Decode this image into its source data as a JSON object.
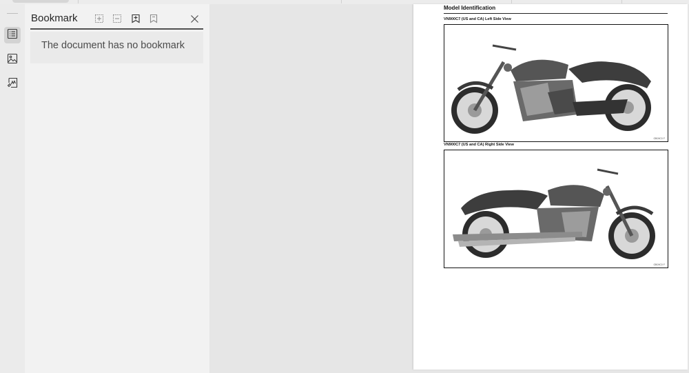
{
  "sidebar_tool_icons": [
    "bookmark-list-icon",
    "image-icon",
    "signature-icon"
  ],
  "bookmark_panel": {
    "title": "Bookmark",
    "header_icons": [
      "expand-all-icon",
      "collapse-all-icon",
      "add-bookmark-icon",
      "bookmark-icon",
      "close-icon"
    ],
    "empty_message": "The document has no bookmark"
  },
  "document": {
    "section_title": "Model Identification",
    "figures": [
      {
        "caption": "VN900C7 (US and CA) Left Side View",
        "code": "GB09C0 F",
        "view": "left"
      },
      {
        "caption": "VN900C7 (US and CA) Right Side View",
        "code": "GB09C0 F",
        "view": "right"
      }
    ]
  },
  "colors": {
    "panel_bg": "#f2f2f2",
    "canvas_bg": "#e6e6e6",
    "rail_active": "#d3d3d3",
    "page_bg": "#ffffff"
  }
}
